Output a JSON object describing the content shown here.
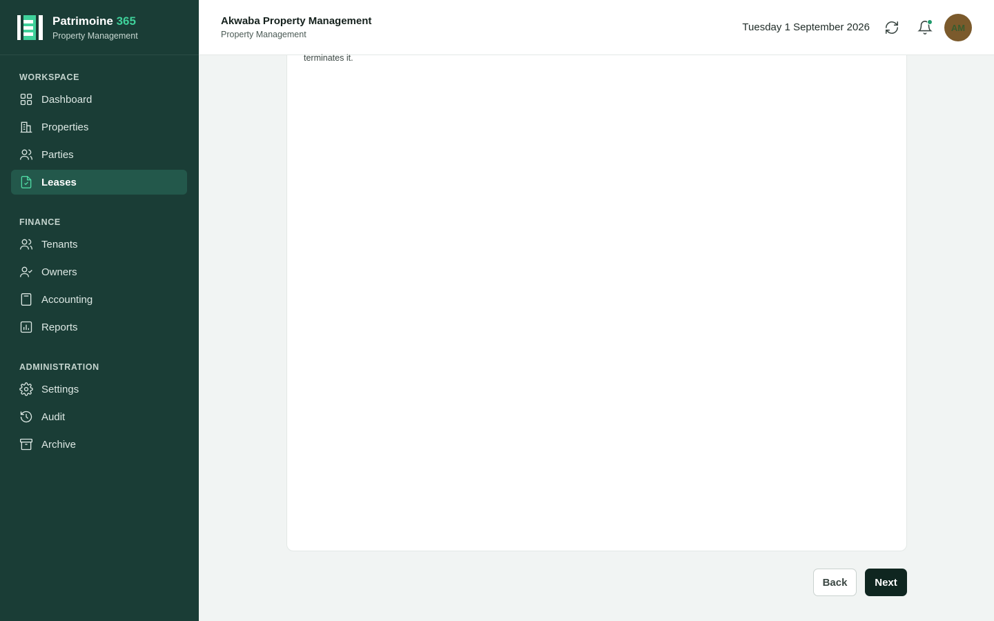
{
  "brand": {
    "name": "Patrimoine",
    "name_accent": "365",
    "subtitle": "Property Management"
  },
  "sidebar": {
    "sections": [
      {
        "label": "WORKSPACE"
      },
      {
        "label": "FINANCE"
      },
      {
        "label": "ADMINISTRATION"
      }
    ],
    "items": [
      {
        "label": "Dashboard",
        "icon": "dashboard-icon"
      },
      {
        "label": "Properties",
        "icon": "building-icon"
      },
      {
        "label": "Parties",
        "icon": "users-icon"
      },
      {
        "label": "Leases",
        "icon": "file-check-icon",
        "active": true
      },
      {
        "label": "Tenants",
        "icon": "users-icon"
      },
      {
        "label": "Owners",
        "icon": "user-check-icon"
      },
      {
        "label": "Accounting",
        "icon": "calculator-icon"
      },
      {
        "label": "Reports",
        "icon": "chart-icon"
      },
      {
        "label": "Settings",
        "icon": "gear-icon"
      },
      {
        "label": "Audit",
        "icon": "history-icon"
      },
      {
        "label": "Archive",
        "icon": "archive-icon"
      }
    ]
  },
  "header": {
    "org_name": "Akwaba Property Management",
    "org_subtitle": "Property Management",
    "date": "Tuesday 1 September 2026",
    "avatar_initials": "AM"
  },
  "main": {
    "card_text": "terminates it."
  },
  "actions": {
    "back_label": "Back",
    "next_label": "Next"
  },
  "colors": {
    "sidebar_bg": "#1a3d36",
    "active_item_bg": "#23584b",
    "accent": "#3fd09a",
    "primary_button": "#0f2620",
    "avatar_bg": "#7b5a2c"
  }
}
